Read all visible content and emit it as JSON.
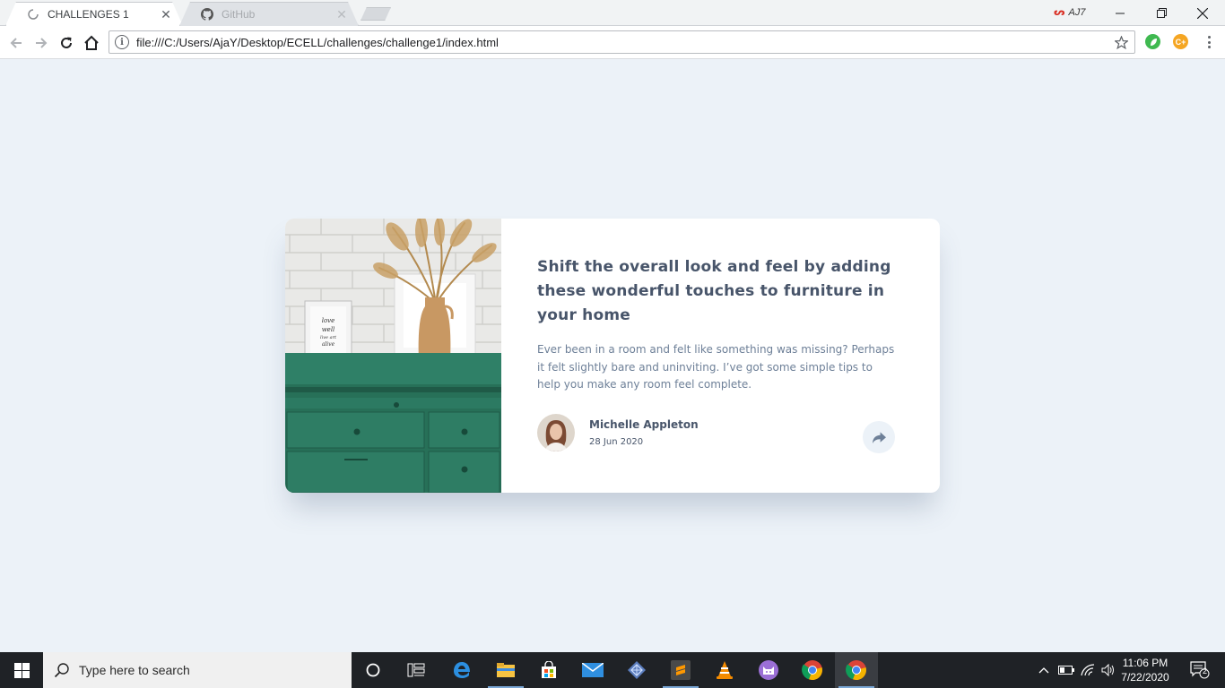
{
  "browser": {
    "tabs": [
      {
        "title": "CHALLENGES 1",
        "active": true
      },
      {
        "title": "GitHub",
        "active": false
      }
    ],
    "profile_label": "AJ7",
    "url": "file:///C:/Users/AjaY/Desktop/ECELL/challenges/challenge1/index.html",
    "extensions": [
      {
        "name": "leaf-extension-icon",
        "color": "#3fb950"
      },
      {
        "name": "coupon-extension-icon",
        "color": "#f5a623",
        "label": "C+"
      }
    ]
  },
  "card": {
    "headline": "Shift the overall look and feel by adding these wonderful touches to furniture in your home",
    "description": "Ever been in a room and felt like something was missing? Perhaps it felt slightly bare and uninviting. I’ve got some simple tips to help you make any room feel complete.",
    "author": {
      "name": "Michelle Appleton",
      "date": "28 Jun 2020"
    },
    "image_frame_text": "love well live art alive"
  },
  "taskbar": {
    "search_placeholder": "Type here to search",
    "pinned": [
      "cortana-icon",
      "task-view-icon",
      "edge-icon",
      "file-explorer-icon",
      "store-icon",
      "mail-icon",
      "network-app-icon",
      "sublime-text-icon",
      "vlc-icon",
      "cat-app-icon",
      "chrome-icon",
      "chrome-icon"
    ],
    "clock_time": "11:06 PM",
    "clock_date": "7/22/2020",
    "notification_count": "2"
  },
  "colors": {
    "page_bg": "#ecf2f8",
    "heading": "#48556a",
    "body_text": "#6e8098",
    "dresser_green": "#2e7d64"
  }
}
